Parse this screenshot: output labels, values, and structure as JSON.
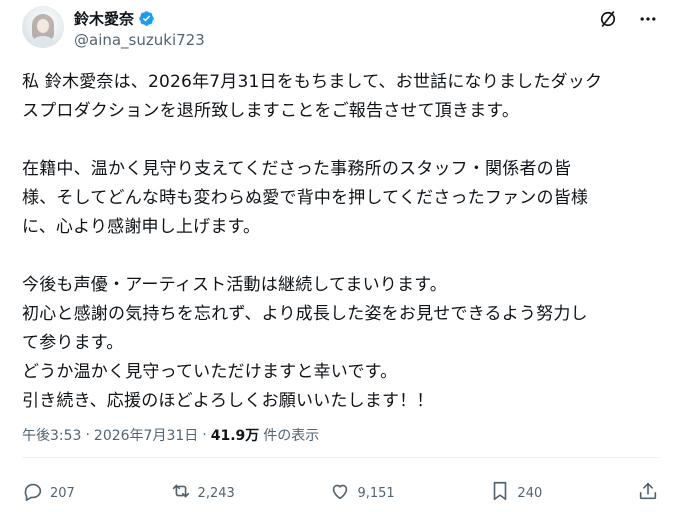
{
  "author": {
    "name": "鈴木愛奈",
    "handle": "@aina_suzuki723"
  },
  "post": {
    "lines": [
      "私 鈴木愛奈は、2026年7月31日をもちまして、お世話になりましたダック",
      "スプロダクションを退所致しますことをご報告させて頂きます。",
      "",
      "在籍中、温かく見守り支えてくださった事務所のスタッフ・関係者の皆",
      "様、そしてどんな時も変わらぬ愛で背中を押してくださったファンの皆様",
      "に、心より感謝申し上げます。",
      "",
      "今後も声優・アーティスト活動は継続してまいります。",
      "初心と感謝の気持ちを忘れず、より成長した姿をお見せできるよう努力し",
      "て参ります。",
      "どうか温かく見守っていただけますと幸いです。",
      "引き続き、応援のほどよろしくお願いいたします！！"
    ]
  },
  "meta": {
    "time": "午後3:53",
    "sep1": "·",
    "date": "2026年7月31日",
    "sep2": "·",
    "views": "41.9万",
    "views_label": "件の表示"
  },
  "actions": {
    "replies": "207",
    "reposts": "2,243",
    "likes": "9,151",
    "bookmarks": "240"
  },
  "icons": [
    "verified-badge-icon",
    "grok-icon",
    "more-icon",
    "reply-icon",
    "repost-icon",
    "like-icon",
    "bookmark-icon",
    "share-icon"
  ],
  "colors": {
    "verified": "#1d9bf0",
    "text": "#0f1419",
    "muted": "#536471"
  }
}
